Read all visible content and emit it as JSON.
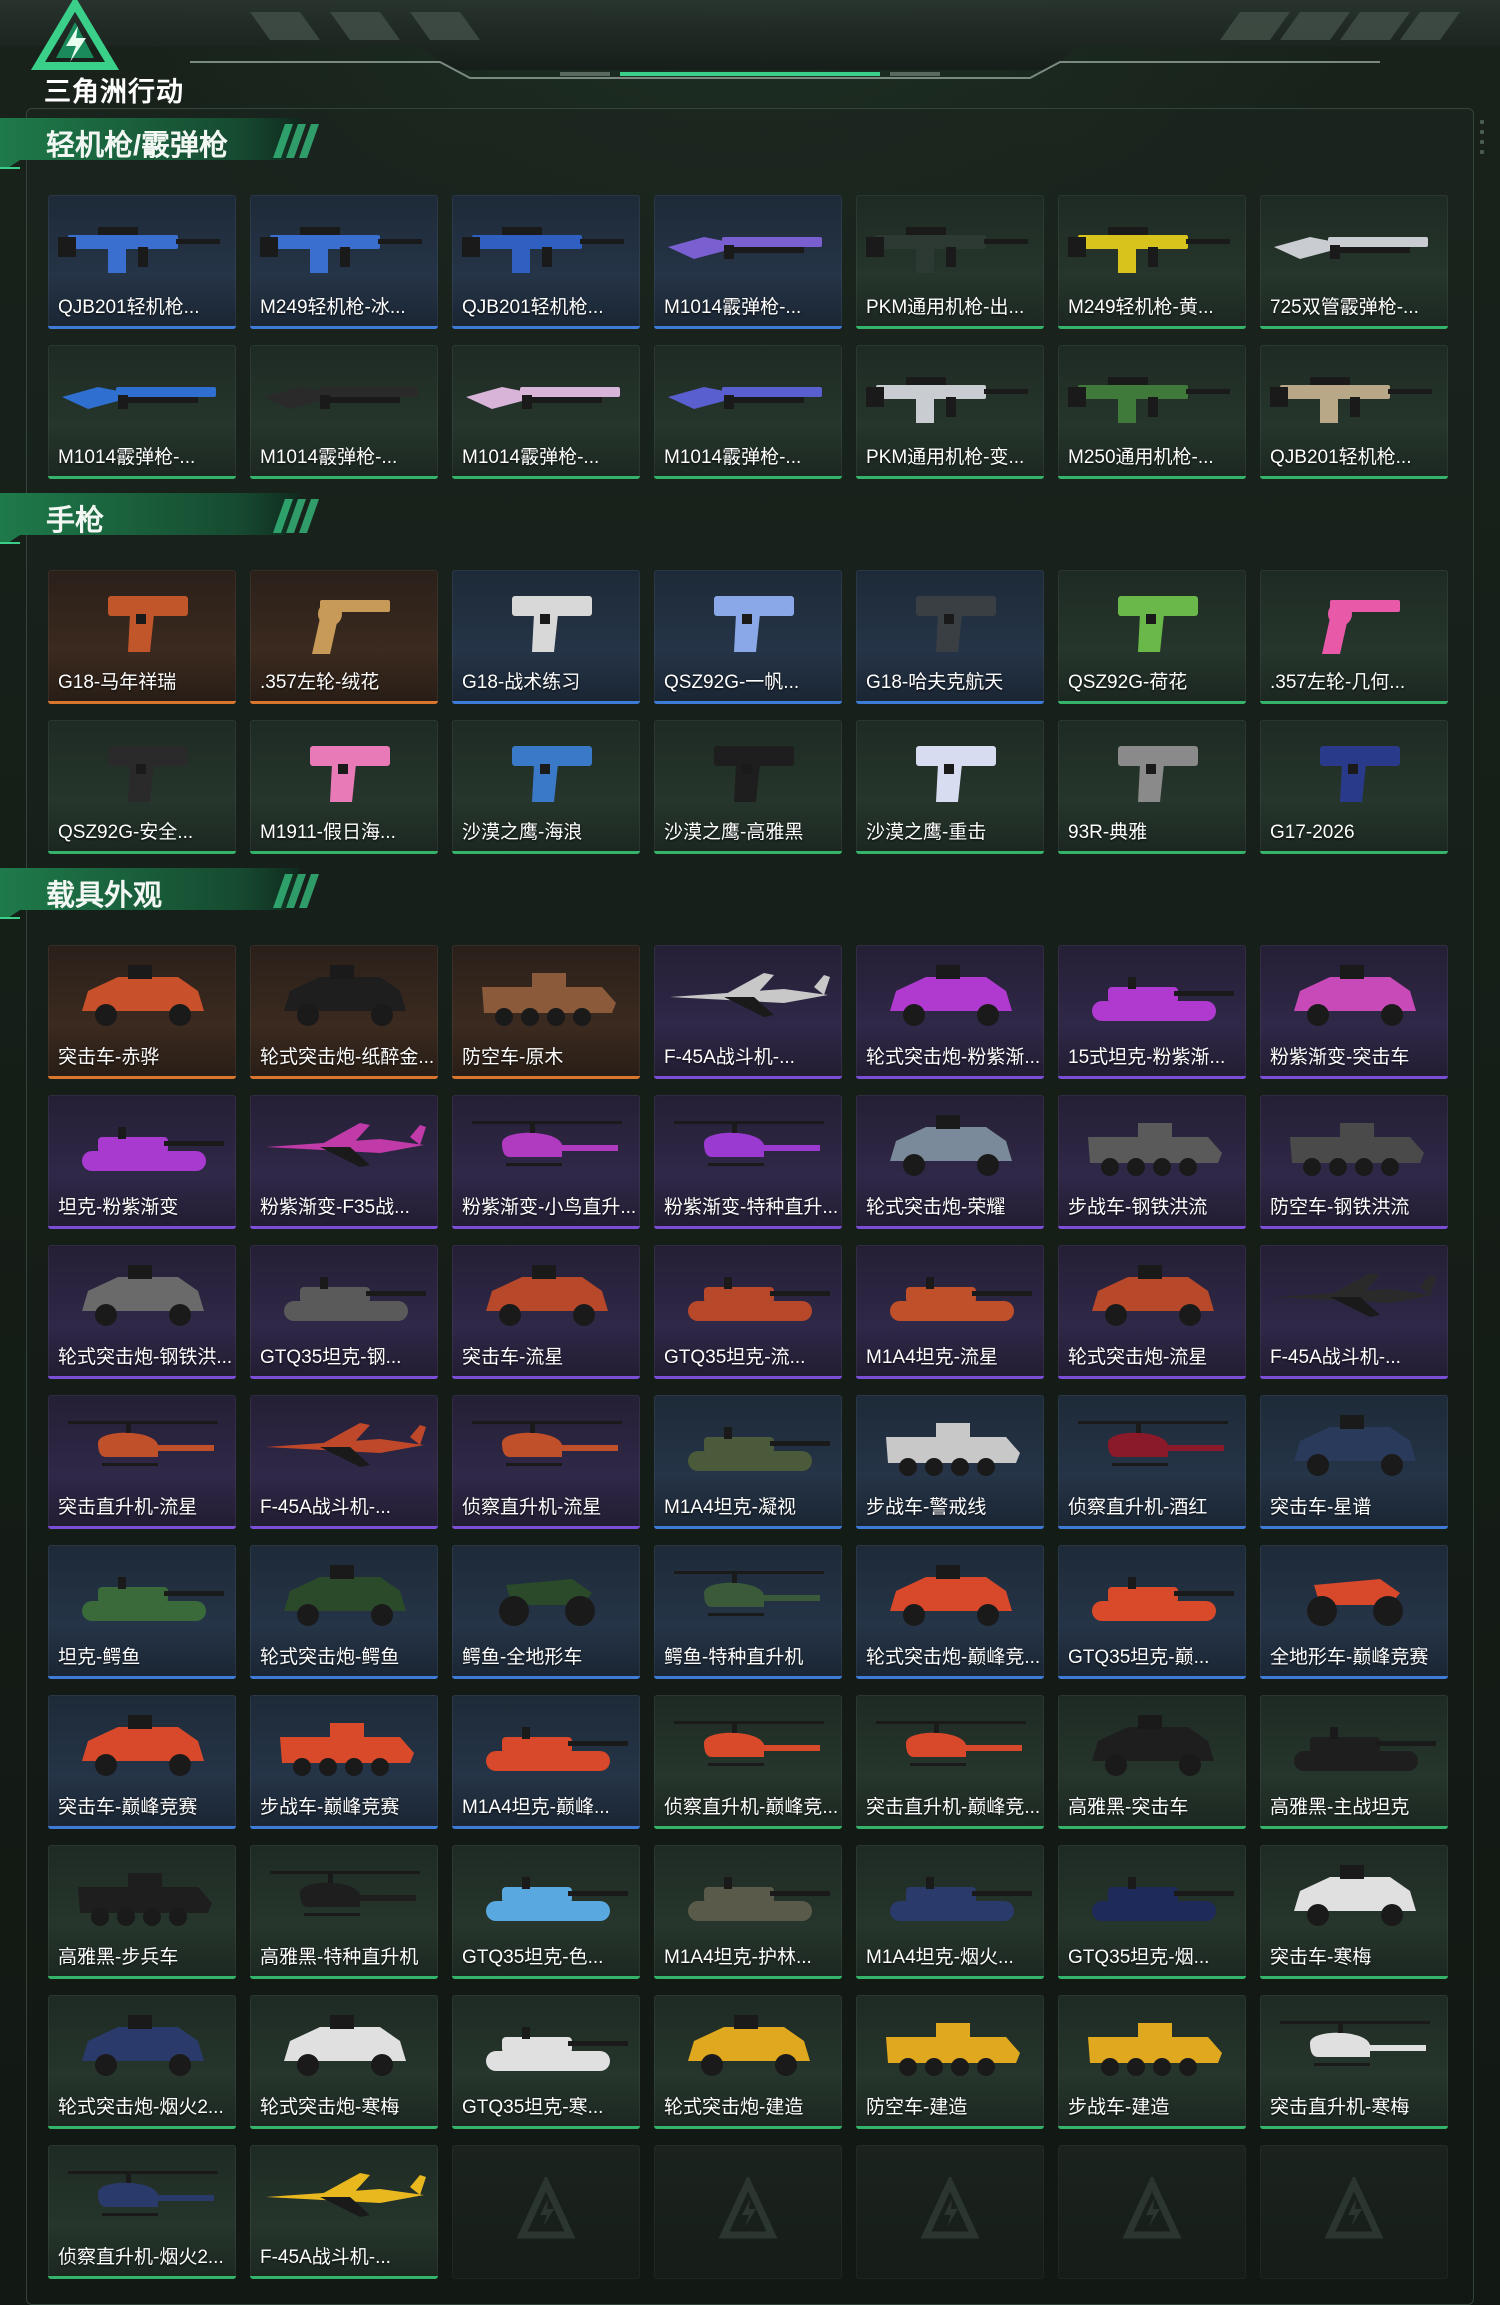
{
  "header": {
    "logo_text": "三角洲行动"
  },
  "sections": [
    {
      "title": "轻机枪/霰弹枪",
      "items": [
        {
          "name": "QJB201轻机枪...",
          "quality": "blue",
          "icon": "lmg-icon",
          "color": "#3a6fd0"
        },
        {
          "name": "M249轻机枪-冰...",
          "quality": "blue",
          "icon": "lmg-icon",
          "color": "#3a6fd0"
        },
        {
          "name": "QJB201轻机枪...",
          "quality": "blue",
          "icon": "lmg-icon",
          "color": "#2f5fc0"
        },
        {
          "name": "M1014霰弹枪-...",
          "quality": "blue",
          "icon": "shotgun-icon",
          "color": "#7a5fd0"
        },
        {
          "name": "PKM通用机枪-出...",
          "quality": "green",
          "icon": "lmg-icon",
          "color": "#2d3a34"
        },
        {
          "name": "M249轻机枪-黄...",
          "quality": "green",
          "icon": "lmg-icon",
          "color": "#d8c21c"
        },
        {
          "name": "725双管霰弹枪-...",
          "quality": "green",
          "icon": "shotgun-icon",
          "color": "#c9ccd0"
        },
        {
          "name": "M1014霰弹枪-...",
          "quality": "green",
          "icon": "shotgun-icon",
          "color": "#2f6fd0"
        },
        {
          "name": "M1014霰弹枪-...",
          "quality": "green",
          "icon": "shotgun-icon",
          "color": "#2a2a2a"
        },
        {
          "name": "M1014霰弹枪-...",
          "quality": "green",
          "icon": "shotgun-icon",
          "color": "#d8b4d8"
        },
        {
          "name": "M1014霰弹枪-...",
          "quality": "green",
          "icon": "shotgun-icon",
          "color": "#5a5fd0"
        },
        {
          "name": "PKM通用机枪-变...",
          "quality": "green",
          "icon": "lmg-icon",
          "color": "#c9ccd0"
        },
        {
          "name": "M250通用机枪-...",
          "quality": "green",
          "icon": "lmg-icon",
          "color": "#3f7a3a"
        },
        {
          "name": "QJB201轻机枪...",
          "quality": "green",
          "icon": "lmg-icon",
          "color": "#b8a888"
        }
      ]
    },
    {
      "title": "手枪",
      "items": [
        {
          "name": "G18-马年祥瑞",
          "quality": "orange",
          "icon": "pistol-icon",
          "color": "#c0562a"
        },
        {
          "name": ".357左轮-绒花",
          "quality": "orange",
          "icon": "revolver-icon",
          "color": "#c89a58"
        },
        {
          "name": "G18-战术练习",
          "quality": "blue",
          "icon": "pistol-icon",
          "color": "#d8d8d8"
        },
        {
          "name": "QSZ92G-一帆...",
          "quality": "blue",
          "icon": "pistol-icon",
          "color": "#8aa8e8"
        },
        {
          "name": "G18-哈夫克航天",
          "quality": "blue",
          "icon": "pistol-icon",
          "color": "#3a3f44"
        },
        {
          "name": "QSZ92G-荷花",
          "quality": "green",
          "icon": "pistol-icon",
          "color": "#6ab84a"
        },
        {
          "name": ".357左轮-几何...",
          "quality": "green",
          "icon": "revolver-icon",
          "color": "#e85aa8"
        },
        {
          "name": "QSZ92G-安全...",
          "quality": "green",
          "icon": "pistol-icon",
          "color": "#2a2a2a"
        },
        {
          "name": "M1911-假日海...",
          "quality": "green",
          "icon": "pistol-icon",
          "color": "#e87ab8"
        },
        {
          "name": "沙漠之鹰-海浪",
          "quality": "green",
          "icon": "pistol-icon",
          "color": "#3a78c8"
        },
        {
          "name": "沙漠之鹰-高雅黑",
          "quality": "green",
          "icon": "pistol-icon",
          "color": "#1e1e1e"
        },
        {
          "name": "沙漠之鹰-重击",
          "quality": "green",
          "icon": "pistol-icon",
          "color": "#d8dcf0"
        },
        {
          "name": "93R-典雅",
          "quality": "green",
          "icon": "pistol-icon",
          "color": "#8a8a8a"
        },
        {
          "name": "G17-2026",
          "quality": "green",
          "icon": "pistol-icon",
          "color": "#2a3a8a"
        }
      ]
    },
    {
      "title": "载具外观",
      "items": [
        {
          "name": "突击车-赤骅",
          "quality": "orange",
          "icon": "armored-car-icon",
          "color": "#c8502a"
        },
        {
          "name": "轮式突击炮-纸醉金...",
          "quality": "orange",
          "icon": "armored-car-icon",
          "color": "#1e1e1e"
        },
        {
          "name": "防空车-原木",
          "quality": "orange",
          "icon": "apc-icon",
          "color": "#8a5a3a"
        },
        {
          "name": "F-45A战斗机-...",
          "quality": "purple",
          "icon": "jet-icon",
          "color": "#c8c8c8"
        },
        {
          "name": "轮式突击炮-粉紫渐...",
          "quality": "purple",
          "icon": "armored-car-icon",
          "color": "#b03ad0"
        },
        {
          "name": "15式坦克-粉紫渐...",
          "quality": "purple",
          "icon": "tank-icon",
          "color": "#b03ad0"
        },
        {
          "name": "粉紫渐变-突击车",
          "quality": "purple",
          "icon": "armored-car-icon",
          "color": "#c84ab8"
        },
        {
          "name": "坦克-粉紫渐变",
          "quality": "purple",
          "icon": "tank-icon",
          "color": "#a83ad0"
        },
        {
          "name": "粉紫渐变-F35战...",
          "quality": "purple",
          "icon": "jet-icon",
          "color": "#c03aa8"
        },
        {
          "name": "粉紫渐变-小鸟直升...",
          "quality": "purple",
          "icon": "helicopter-icon",
          "color": "#b03ac0"
        },
        {
          "name": "粉紫渐变-特种直升...",
          "quality": "purple",
          "icon": "helicopter-icon",
          "color": "#9a3ad0"
        },
        {
          "name": "轮式突击炮-荣耀",
          "quality": "purple",
          "icon": "armored-car-icon",
          "color": "#7a8a9a"
        },
        {
          "name": "步战车-钢铁洪流",
          "quality": "purple",
          "icon": "apc-icon",
          "color": "#5a5a5a"
        },
        {
          "name": "防空车-钢铁洪流",
          "quality": "purple",
          "icon": "apc-icon",
          "color": "#4a4a4a"
        },
        {
          "name": "轮式突击炮-钢铁洪...",
          "quality": "purple",
          "icon": "armored-car-icon",
          "color": "#6a6a6a"
        },
        {
          "name": "GTQ35坦克-钢...",
          "quality": "purple",
          "icon": "tank-icon",
          "color": "#5a5a5a"
        },
        {
          "name": "突击车-流星",
          "quality": "purple",
          "icon": "armored-car-icon",
          "color": "#b8482a"
        },
        {
          "name": "GTQ35坦克-流...",
          "quality": "purple",
          "icon": "tank-icon",
          "color": "#b8482a"
        },
        {
          "name": "M1A4坦克-流星",
          "quality": "purple",
          "icon": "tank-icon",
          "color": "#c0502a"
        },
        {
          "name": "轮式突击炮-流星",
          "quality": "purple",
          "icon": "armored-car-icon",
          "color": "#b8482a"
        },
        {
          "name": "F-45A战斗机-...",
          "quality": "purple",
          "icon": "jet-icon",
          "color": "#2a2a2a"
        },
        {
          "name": "突击直升机-流星",
          "quality": "purple",
          "icon": "helicopter-icon",
          "color": "#c0502a"
        },
        {
          "name": "F-45A战斗机-...",
          "quality": "purple",
          "icon": "jet-icon",
          "color": "#c0482a"
        },
        {
          "name": "侦察直升机-流星",
          "quality": "purple",
          "icon": "helicopter-icon",
          "color": "#c0502a"
        },
        {
          "name": "M1A4坦克-凝视",
          "quality": "blue",
          "icon": "tank-icon",
          "color": "#4a5a3a"
        },
        {
          "name": "步战车-警戒线",
          "quality": "blue",
          "icon": "apc-icon",
          "color": "#c8c8c8"
        },
        {
          "name": "侦察直升机-酒红",
          "quality": "blue",
          "icon": "helicopter-icon",
          "color": "#8a1a2a"
        },
        {
          "name": "突击车-星谱",
          "quality": "blue",
          "icon": "armored-car-icon",
          "color": "#2a3a5a"
        },
        {
          "name": "坦克-鳄鱼",
          "quality": "blue",
          "icon": "tank-icon",
          "color": "#3a6a3a"
        },
        {
          "name": "轮式突击炮-鳄鱼",
          "quality": "blue",
          "icon": "armored-car-icon",
          "color": "#2a4a2a"
        },
        {
          "name": "鳄鱼-全地形车",
          "quality": "blue",
          "icon": "atv-icon",
          "color": "#2a4a2a"
        },
        {
          "name": "鳄鱼-特种直升机",
          "quality": "blue",
          "icon": "helicopter-icon",
          "color": "#3a5a3a"
        },
        {
          "name": "轮式突击炮-巅峰竞...",
          "quality": "blue",
          "icon": "armored-car-icon",
          "color": "#d8482a"
        },
        {
          "name": "GTQ35坦克-巅...",
          "quality": "blue",
          "icon": "tank-icon",
          "color": "#d84a2a"
        },
        {
          "name": "全地形车-巅峰竞赛",
          "quality": "blue",
          "icon": "atv-icon",
          "color": "#d8482a"
        },
        {
          "name": "突击车-巅峰竞赛",
          "quality": "blue",
          "icon": "armored-car-icon",
          "color": "#d8482a"
        },
        {
          "name": "步战车-巅峰竞赛",
          "quality": "blue",
          "icon": "apc-icon",
          "color": "#d84a2a"
        },
        {
          "name": "M1A4坦克-巅峰...",
          "quality": "blue",
          "icon": "tank-icon",
          "color": "#d8482a"
        },
        {
          "name": "侦察直升机-巅峰竞...",
          "quality": "green",
          "icon": "helicopter-icon",
          "color": "#d84a2a"
        },
        {
          "name": "突击直升机-巅峰竞...",
          "quality": "green",
          "icon": "helicopter-icon",
          "color": "#d8482a"
        },
        {
          "name": "高雅黑-突击车",
          "quality": "green",
          "icon": "armored-car-icon",
          "color": "#1e1e1e"
        },
        {
          "name": "高雅黑-主战坦克",
          "quality": "green",
          "icon": "tank-icon",
          "color": "#1e1e1e"
        },
        {
          "name": "高雅黑-步兵车",
          "quality": "green",
          "icon": "apc-icon",
          "color": "#1e1e1e"
        },
        {
          "name": "高雅黑-特种直升机",
          "quality": "green",
          "icon": "helicopter-icon",
          "color": "#1e1e1e"
        },
        {
          "name": "GTQ35坦克-色...",
          "quality": "green",
          "icon": "tank-icon",
          "color": "#5aa8e0"
        },
        {
          "name": "M1A4坦克-护林...",
          "quality": "green",
          "icon": "tank-icon",
          "color": "#5a5a4a"
        },
        {
          "name": "M1A4坦克-烟火...",
          "quality": "green",
          "icon": "tank-icon",
          "color": "#2a3a6a"
        },
        {
          "name": "GTQ35坦克-烟...",
          "quality": "green",
          "icon": "tank-icon",
          "color": "#1e2a5a"
        },
        {
          "name": "突击车-寒梅",
          "quality": "green",
          "icon": "armored-car-icon",
          "color": "#e0e0e0"
        },
        {
          "name": "轮式突击炮-烟火2...",
          "quality": "green",
          "icon": "armored-car-icon",
          "color": "#2a3a6a"
        },
        {
          "name": "轮式突击炮-寒梅",
          "quality": "green",
          "icon": "armored-car-icon",
          "color": "#e0e0e0"
        },
        {
          "name": "GTQ35坦克-寒...",
          "quality": "green",
          "icon": "tank-icon",
          "color": "#e0e0e0"
        },
        {
          "name": "轮式突击炮-建造",
          "quality": "green",
          "icon": "armored-car-icon",
          "color": "#e0a81e"
        },
        {
          "name": "防空车-建造",
          "quality": "green",
          "icon": "apc-icon",
          "color": "#e0a81e"
        },
        {
          "name": "步战车-建造",
          "quality": "green",
          "icon": "apc-icon",
          "color": "#e0a81e"
        },
        {
          "name": "突击直升机-寒梅",
          "quality": "green",
          "icon": "helicopter-icon",
          "color": "#e0e0e0"
        },
        {
          "name": "侦察直升机-烟火2...",
          "quality": "green",
          "icon": "helicopter-icon",
          "color": "#2a3a6a"
        },
        {
          "name": "F-45A战斗机-...",
          "quality": "green",
          "icon": "jet-icon",
          "color": "#e8b81e"
        },
        {
          "empty": true
        },
        {
          "empty": true
        },
        {
          "empty": true
        },
        {
          "empty": true
        },
        {
          "empty": true
        }
      ]
    }
  ]
}
